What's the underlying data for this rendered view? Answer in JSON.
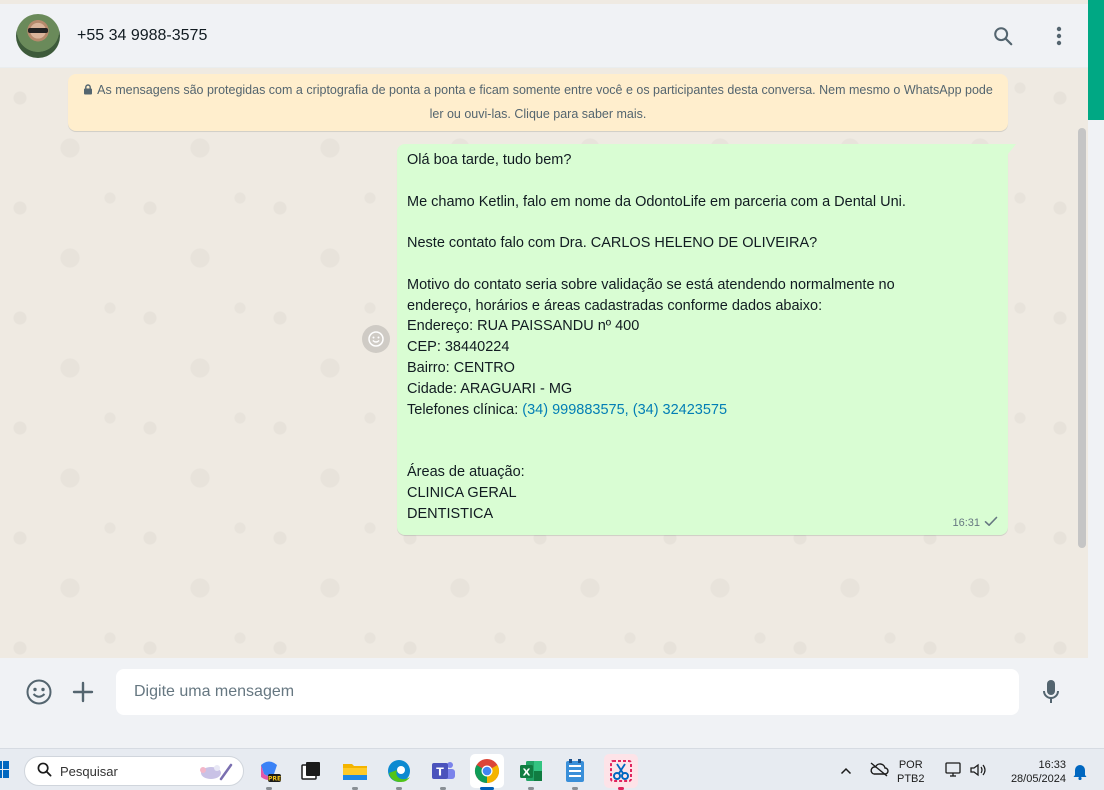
{
  "header": {
    "contact_name": "+55 34 9988-3575",
    "icons": [
      "search-icon",
      "menu-icon"
    ]
  },
  "encryption_notice": "As mensagens são protegidas com a criptografia de ponta a ponta e ficam somente entre você e os participantes desta conversa. Nem mesmo o WhatsApp pode ler ou ouvi-las. Clique para saber mais.",
  "message": {
    "lines_before_link": "Olá boa tarde, tudo bem?\n\nMe chamo Ketlin, falo em nome da OdontoLife em parceria com a Dental Uni.\n\nNeste contato falo com Dra. CARLOS HELENO DE OLIVEIRA?\n\nMotivo do contato seria sobre validação se está atendendo normalmente no\nendereço, horários e áreas cadastradas conforme dados abaixo:\nEndereço: RUA PAISSANDU nº 400\nCEP: 38440224\nBairro: CENTRO\nCidade: ARAGUARI - MG\nTelefones clínica: ",
    "phone_link_1": "(34) 999883575",
    "link_separator": ", ",
    "phone_link_2": "(34) 32423575",
    "lines_after_link": "\n\n\nÁreas de atuação:\nCLINICA GERAL\nDENTISTICA",
    "time": "16:31",
    "status": "sent"
  },
  "composer": {
    "placeholder": "Digite uma mensagem"
  },
  "taskbar": {
    "search_label": "Pesquisar",
    "apps": [
      "copilot-icon",
      "task-view-icon",
      "file-explorer-icon",
      "edge-icon",
      "teams-icon",
      "chrome-icon",
      "excel-icon",
      "notepad-icon",
      "snipping-tool-icon"
    ],
    "active_app": "chrome-icon",
    "lang_top": "POR",
    "lang_bottom": "PTB2",
    "time": "16:33",
    "date": "28/05/2024"
  },
  "colors": {
    "accent": "#00a884",
    "bubble_out": "#d9fdd3",
    "notice_bg": "#ffeecd",
    "link": "#027eb5"
  }
}
